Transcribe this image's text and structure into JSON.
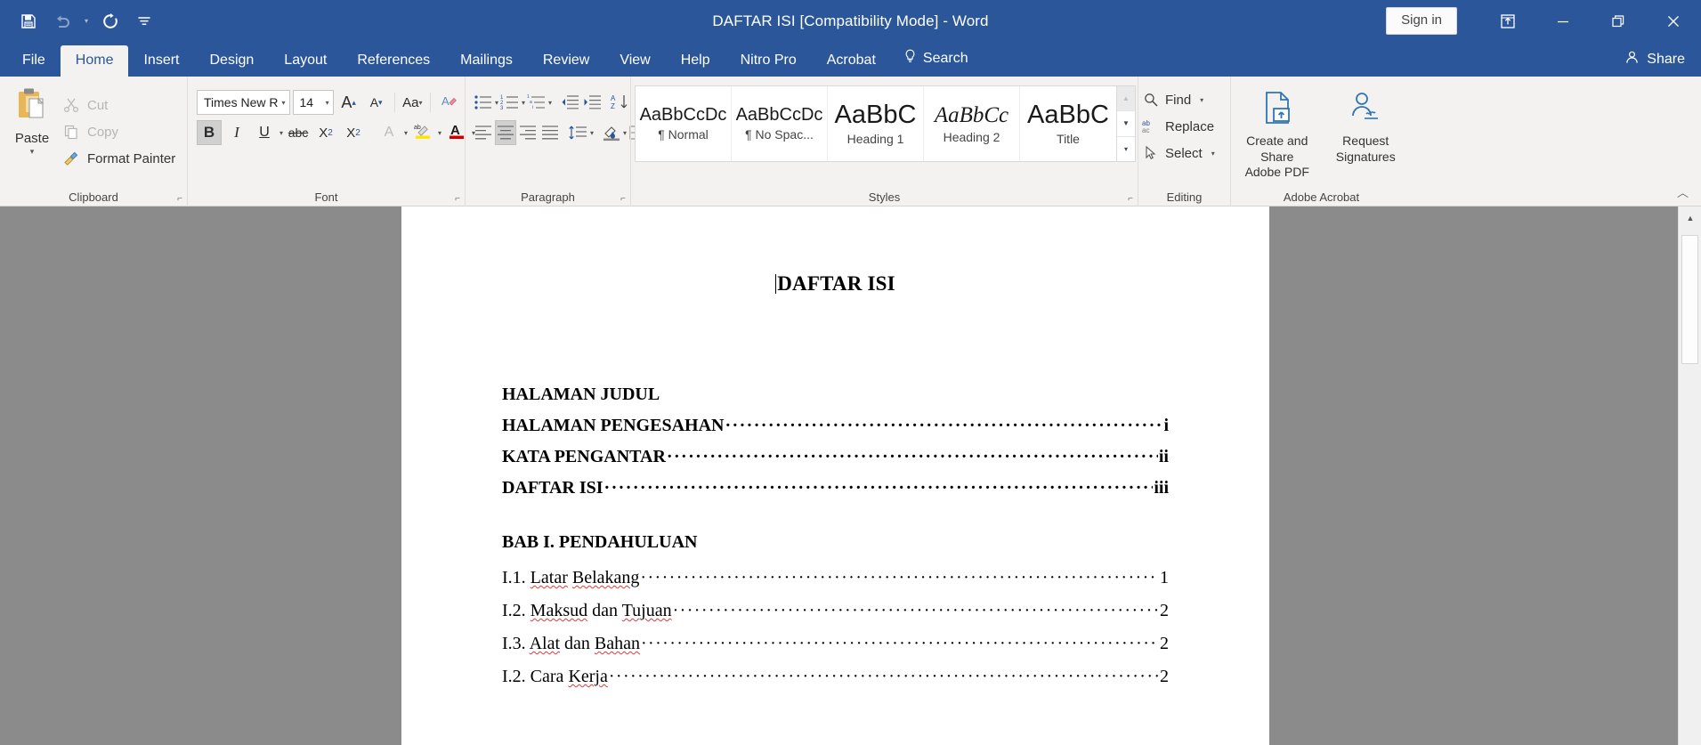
{
  "titlebar": {
    "doc_title": "DAFTAR ISI [Compatibility Mode]  -  Word",
    "signin_label": "Sign in",
    "quick_access": [
      {
        "name": "save-icon",
        "label": "Save",
        "enabled": true
      },
      {
        "name": "undo-icon",
        "label": "Undo",
        "enabled": false
      },
      {
        "name": "redo-icon",
        "label": "Redo",
        "enabled": true
      },
      {
        "name": "customize-quick-access-icon",
        "label": "Customize Quick Access Toolbar",
        "enabled": true
      }
    ],
    "window_buttons": [
      {
        "name": "ribbon-display-options-icon",
        "label": "Ribbon Display Options"
      },
      {
        "name": "minimize-icon",
        "label": "Minimize"
      },
      {
        "name": "restore-icon",
        "label": "Restore Down"
      },
      {
        "name": "close-icon",
        "label": "Close"
      }
    ]
  },
  "tabs": [
    {
      "label": "File",
      "active": false
    },
    {
      "label": "Home",
      "active": true
    },
    {
      "label": "Insert",
      "active": false
    },
    {
      "label": "Design",
      "active": false
    },
    {
      "label": "Layout",
      "active": false
    },
    {
      "label": "References",
      "active": false
    },
    {
      "label": "Mailings",
      "active": false
    },
    {
      "label": "Review",
      "active": false
    },
    {
      "label": "View",
      "active": false
    },
    {
      "label": "Help",
      "active": false
    },
    {
      "label": "Nitro Pro",
      "active": false
    },
    {
      "label": "Acrobat",
      "active": false
    }
  ],
  "search": {
    "label": "Search"
  },
  "share": {
    "label": "Share"
  },
  "ribbon": {
    "collapse_label": "Collapse the Ribbon",
    "clipboard": {
      "group_label": "Clipboard",
      "paste_label": "Paste",
      "cut_label": "Cut",
      "copy_label": "Copy",
      "format_painter_label": "Format Painter"
    },
    "font": {
      "group_label": "Font",
      "font_name": "Times New R",
      "font_size": "14",
      "grow_font_label": "A",
      "shrink_font_label": "A",
      "change_case_label": "Aa",
      "clear_formatting_label": "A",
      "bold_label": "B",
      "italic_label": "I",
      "underline_label": "U",
      "strikethrough_label": "abc",
      "subscript_label": "X",
      "subscript_sub": "2",
      "superscript_label": "X",
      "superscript_sup": "2",
      "text_effects_label": "A",
      "highlight_label": "ab",
      "font_color_label": "A"
    },
    "paragraph": {
      "group_label": "Paragraph",
      "buttons": [
        "bullets",
        "numbering",
        "multilevel-list",
        "decrease-indent",
        "increase-indent",
        "sort",
        "show-formatting-marks",
        "align-left",
        "align-center",
        "align-right",
        "justify",
        "line-spacing",
        "shading",
        "borders"
      ]
    },
    "styles": {
      "group_label": "Styles",
      "items": [
        {
          "preview": "AaBbCcDc",
          "name": "¶ Normal",
          "size": "20px",
          "weight": "normal",
          "style": "normal"
        },
        {
          "preview": "AaBbCcDc",
          "name": "¶ No Spac...",
          "size": "20px",
          "weight": "normal",
          "style": "normal"
        },
        {
          "preview": "AaBbC",
          "name": "Heading 1",
          "size": "29px",
          "weight": "normal",
          "style": "normal"
        },
        {
          "preview": "AaBbCc",
          "name": "Heading 2",
          "size": "25px",
          "weight": "normal",
          "style": "italic"
        },
        {
          "preview": "AaBbC",
          "name": "Title",
          "size": "29px",
          "weight": "normal",
          "style": "normal"
        }
      ],
      "scroll_up_label": "Scroll up styles",
      "scroll_down_label": "Scroll down styles",
      "more_label": "More styles"
    },
    "editing": {
      "group_label": "Editing",
      "find_label": "Find",
      "replace_label": "Replace",
      "select_label": "Select"
    },
    "acrobat": {
      "group_label": "Adobe Acrobat",
      "create_share_label": "Create and Share\nAdobe PDF",
      "request_signatures_label": "Request\nSignatures"
    }
  },
  "document": {
    "heading": "DAFTAR ISI",
    "leader_char": "·",
    "entries": [
      {
        "label": "HALAMAN JUDUL",
        "page": "",
        "bold": true,
        "leader": false,
        "spaced_top": false
      },
      {
        "label": "HALAMAN PENGESAHAN",
        "page": "i",
        "bold": true,
        "leader": true,
        "spaced_top": false
      },
      {
        "label": "KATA PENGANTAR",
        "page": "ii",
        "bold": true,
        "leader": true,
        "spaced_top": false
      },
      {
        "label": "DAFTAR ISI",
        "page": "iii",
        "bold": true,
        "leader": true,
        "spaced_top": false
      },
      {
        "label": "BAB I. PENDAHULUAN",
        "page": "",
        "bold": true,
        "leader": false,
        "spaced_top": true
      },
      {
        "label": "I.1. Latar Belakang",
        "page": "1",
        "bold": false,
        "leader": true,
        "spaced_top": false,
        "misspelled": [
          "Latar",
          "Belakang"
        ]
      },
      {
        "label": "I.2. Maksud dan Tujuan",
        "page": "2",
        "bold": false,
        "leader": true,
        "spaced_top": false,
        "misspelled": [
          "Maksud",
          "Tujuan"
        ]
      },
      {
        "label": "I.3. Alat dan Bahan",
        "page": "2",
        "bold": false,
        "leader": true,
        "spaced_top": false,
        "misspelled": [
          "Alat",
          "Bahan"
        ]
      },
      {
        "label": "I.2. Cara Kerja",
        "page": "2",
        "bold": false,
        "leader": true,
        "spaced_top": false,
        "misspelled": [
          "Kerja"
        ]
      }
    ]
  },
  "scrollbar": {
    "up_label": "▲",
    "down_label": "▼"
  },
  "colors": {
    "titlebar_blue": "#2b579a",
    "ribbon_bg": "#f3f2f1",
    "doc_bg": "#8b8b8b",
    "accent_red": "#e03a3a",
    "acrobat_blue": "#2e75b6"
  }
}
